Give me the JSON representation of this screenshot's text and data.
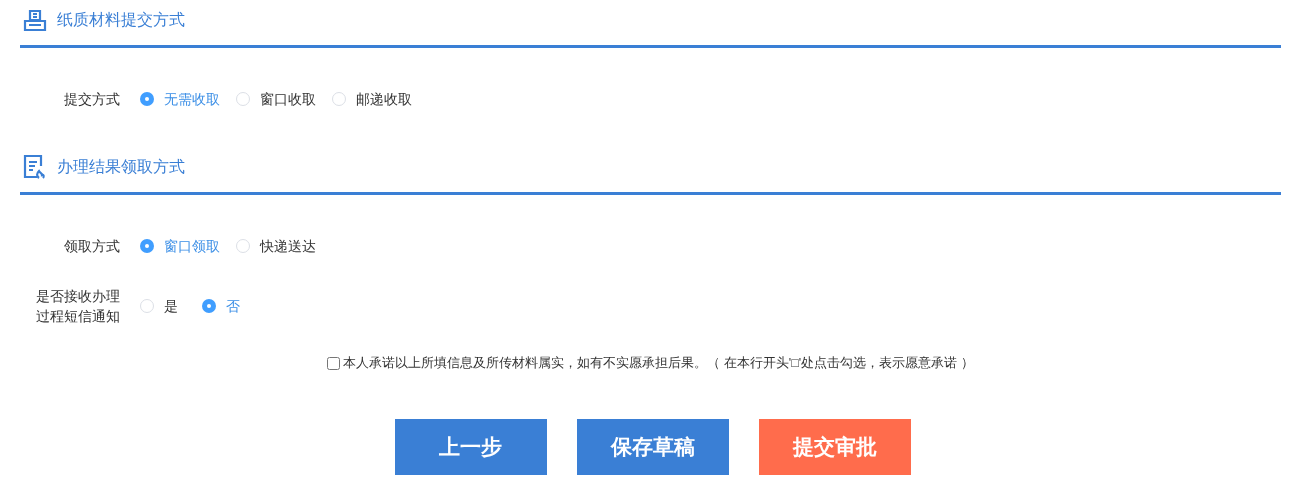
{
  "sections": [
    {
      "title": "纸质材料提交方式",
      "fields": [
        {
          "label": "提交方式",
          "options": [
            {
              "label": "无需收取",
              "selected": true
            },
            {
              "label": "窗口收取",
              "selected": false
            },
            {
              "label": "邮递收取",
              "selected": false
            }
          ]
        }
      ]
    },
    {
      "title": "办理结果领取方式",
      "fields": [
        {
          "label": "领取方式",
          "options": [
            {
              "label": "窗口领取",
              "selected": true
            },
            {
              "label": "快递送达",
              "selected": false
            }
          ]
        },
        {
          "label": "是否接收办理过程短信通知",
          "options": [
            {
              "label": "是",
              "selected": false
            },
            {
              "label": "否",
              "selected": true
            }
          ]
        }
      ]
    }
  ],
  "commitment": {
    "checked": false,
    "text": "本人承诺以上所填信息及所传材料属实，如有不实愿承担后果。（ 在本行开头'□'处点击勾选，表示愿意承诺 ）"
  },
  "buttons": [
    {
      "label": "上一步",
      "kind": "secondary"
    },
    {
      "label": "保存草稿",
      "kind": "secondary"
    },
    {
      "label": "提交审批",
      "kind": "primary"
    }
  ]
}
